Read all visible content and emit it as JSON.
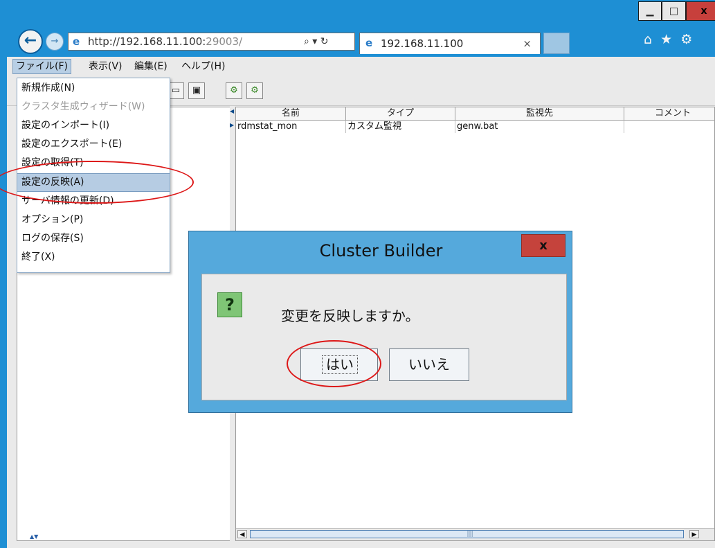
{
  "browser": {
    "url_host": "http://192.168.11.100:",
    "url_port": "29003/",
    "url_controls": "⌕ ▾ ↻",
    "tab_title": "192.168.11.100",
    "tab_close": "×",
    "window_buttons": {
      "minimize": "▁",
      "maximize": "□",
      "close": "x"
    },
    "toolbar_icons": [
      "home-icon",
      "favorites-star-icon",
      "settings-gear-icon"
    ]
  },
  "app": {
    "menubar": [
      {
        "label": "ファイル(F)"
      },
      {
        "label": "表示(V)"
      },
      {
        "label": "編集(E)"
      },
      {
        "label": "ヘルプ(H)"
      }
    ],
    "file_menu": [
      {
        "label": "新規作成(N)",
        "disabled": false,
        "selected": false
      },
      {
        "label": "クラスタ生成ウィザード(W)",
        "disabled": true,
        "selected": false
      },
      {
        "label": "設定のインポート(I)",
        "disabled": false,
        "selected": false
      },
      {
        "label": "設定のエクスポート(E)",
        "disabled": false,
        "selected": false
      },
      {
        "label": "設定の取得(T)",
        "disabled": false,
        "selected": false
      },
      {
        "label": "設定の反映(A)",
        "disabled": false,
        "selected": true
      },
      {
        "label": "サーバ情報の更新(D)",
        "disabled": false,
        "selected": false
      },
      {
        "label": "オプション(P)",
        "disabled": false,
        "selected": false
      },
      {
        "label": "ログの保存(S)",
        "disabled": false,
        "selected": false
      },
      {
        "label": "終了(X)",
        "disabled": false,
        "selected": false
      }
    ],
    "table": {
      "columns": [
        "名前",
        "タイプ",
        "監視先",
        "コメント"
      ],
      "rows": [
        [
          "rdmstat_mon",
          "カスタム監視",
          "genw.bat",
          ""
        ]
      ]
    }
  },
  "dialog": {
    "title": "Cluster Builder",
    "close_label": "x",
    "icon": "question-icon",
    "message": "変更を反映しますか。",
    "yes_label": "はい",
    "no_label": "いいえ"
  },
  "annotations": {
    "color": "#dd1818"
  }
}
